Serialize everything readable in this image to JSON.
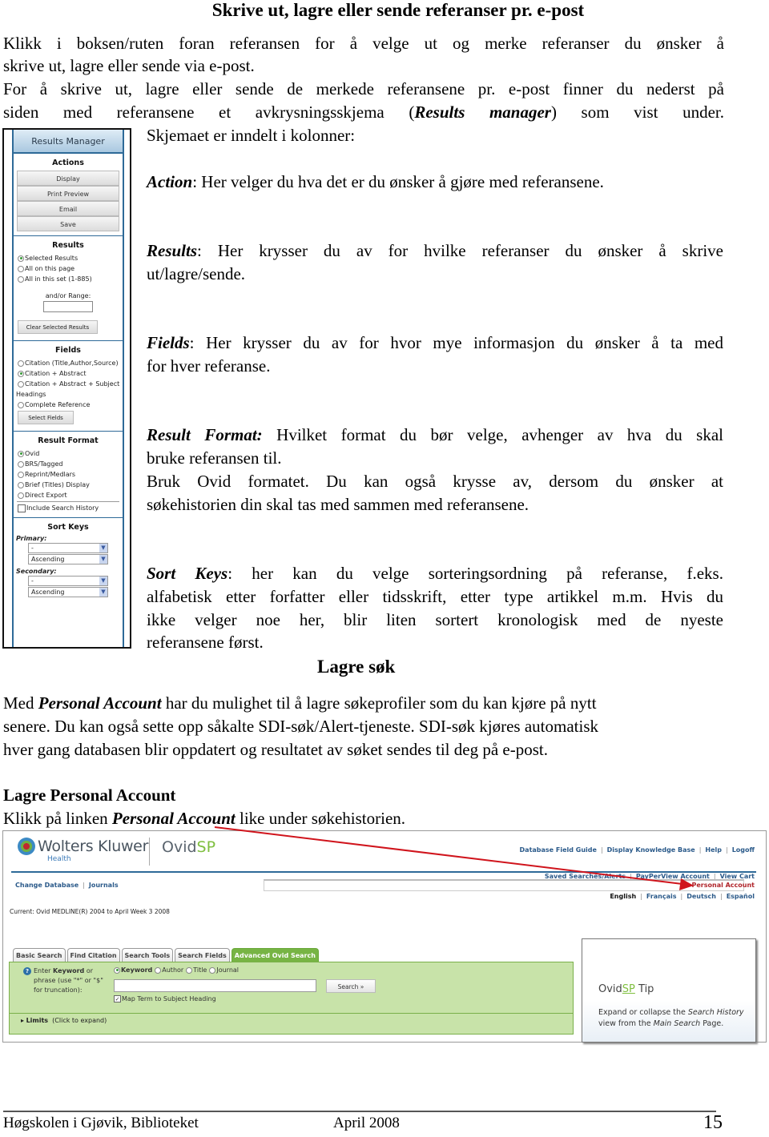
{
  "doc": {
    "title": "Skrive ut, lagre eller sende referanser pr. e-post",
    "intro": {
      "line1": "Klikk i boksen/ruten foran referansen for å velge ut og merke referanser du ønsker å",
      "line2": "skrive ut, lagre eller sende via e-post.",
      "line3": "For å skrive ut, lagre eller sende de merkede referansene pr. e-post finner du nederst på",
      "line4_a": "siden med referansene et avkrysningsskjema (",
      "line4_em": "Results manager",
      "line4_b": ") som vist under.",
      "line5": "Skjemaet er inndelt i kolonner:"
    },
    "items": [
      {
        "term": "Action",
        "sep": ": ",
        "text": "Her velger du hva det er du ønsker å gjøre med referansene."
      },
      {
        "term": "Results",
        "sep": ": ",
        "text1": "Her krysser du av for hvilke referanser du ønsker å skrive",
        "text2": "ut/lagre/sende."
      },
      {
        "term": "Fields",
        "sep": ": ",
        "text1": "Her krysser du av for hvor mye informasjon du ønsker å ta med",
        "text2": "for hver referanse."
      },
      {
        "term": "Result Format:",
        "sep": " ",
        "text1": "Hvilket format du bør velge, avhenger av hva du skal",
        "text2": "bruke referansen til.",
        "text3": "Bruk Ovid formatet. Du kan også krysse av, dersom du ønsker at",
        "text4": "søkehistorien din skal tas med sammen med referansene."
      },
      {
        "term": "Sort Keys",
        "sep": ": ",
        "text1": "her kan du velge sorteringsordning på referanse, f.eks.",
        "text2": "alfabetisk etter forfatter eller tidsskrift, etter type artikkel m.m. Hvis du",
        "text3": "ikke velger noe her, blir liten sortert kronologisk med de nyeste",
        "text4": "referansene først."
      }
    ],
    "heading2": "Lagre søk",
    "para2": {
      "pre": "Med ",
      "em": "Personal Account",
      "line1_post": " har du mulighet til å lagre søkeprofiler som du kan kjøre på nytt",
      "line2": "senere. Du kan også sette opp såkalte SDI-søk/Alert-tjeneste. SDI-søk kjøres automatisk",
      "line3": "hver gang databasen blir oppdatert og resultatet av søket sendes til deg på e-post."
    },
    "heading3": "Lagre Personal Account",
    "para3": {
      "pre": "Klikk på linken ",
      "em": "Personal Account",
      "post": " like under søkehistorien."
    },
    "footer": {
      "left": "Høgskolen i Gjøvik, Biblioteket",
      "center": "April 2008",
      "page": "15"
    }
  },
  "results_manager": {
    "header": "Results Manager",
    "actions": {
      "title": "Actions",
      "buttons": [
        "Display",
        "Print Preview",
        "Email",
        "Save"
      ]
    },
    "results": {
      "title": "Results",
      "options": [
        {
          "label": "Selected Results",
          "selected": true
        },
        {
          "label": "All on this page",
          "selected": false
        },
        {
          "label": "All in this set (1-885)",
          "selected": false
        }
      ],
      "range_label": "and/or Range:",
      "range_value": "",
      "clear_button": "Clear Selected Results"
    },
    "fields": {
      "title": "Fields",
      "options": [
        {
          "label": "Citation (Title,Author,Source)",
          "selected": false
        },
        {
          "label": "Citation + Abstract",
          "selected": true
        },
        {
          "label": "Citation + Abstract + Subject",
          "selected": false
        }
      ],
      "wrap_text": "Headings",
      "option4": {
        "label": "Complete Reference",
        "selected": false
      },
      "select_button": "Select Fields"
    },
    "result_format": {
      "title": "Result Format",
      "options": [
        {
          "label": "Ovid",
          "selected": true
        },
        {
          "label": "BRS/Tagged",
          "selected": false
        },
        {
          "label": "Reprint/Medlars",
          "selected": false
        },
        {
          "label": "Brief (Titles) Display",
          "selected": false
        },
        {
          "label": "Direct Export",
          "selected": false
        }
      ],
      "include_history_label": "Include Search History",
      "include_history_checked": false
    },
    "sort_keys": {
      "title": "Sort Keys",
      "primary_label": "Primary:",
      "primary_field": "-",
      "primary_order": "Ascending",
      "secondary_label": "Secondary:",
      "secondary_field": "-",
      "secondary_order": "Ascending"
    }
  },
  "ovid": {
    "brand": "Wolters Kluwer",
    "brand_sub": "Health",
    "product_a": "Ovid",
    "product_b": "SP",
    "top_links": [
      "Database Field Guide",
      "Display Knowledge Base",
      "Help",
      "Logoff"
    ],
    "sub_links": [
      "Saved Searches/Alerts",
      "PayPerView Account",
      "View Cart"
    ],
    "personal_account": "Personal Account",
    "languages": [
      "English",
      "Français",
      "Deutsch",
      "Español"
    ],
    "active_language": "English",
    "nav_links": [
      "Change Database",
      "Journals"
    ],
    "current_label": "Current:",
    "current_db": "Ovid MEDLINE(R) 2004 to April Week 3 2008",
    "tabs": [
      {
        "label": "Basic Search",
        "active": false
      },
      {
        "label": "Find Citation",
        "active": false
      },
      {
        "label": "Search Tools",
        "active": false
      },
      {
        "label": "Search Fields",
        "active": false
      },
      {
        "label": "Advanced Ovid Search",
        "active": true
      }
    ],
    "enter_keyword": {
      "pre": "Enter ",
      "bold": "Keyword",
      "post": " or phrase (use \"*\" or \"$\" for truncation):"
    },
    "search_types": [
      {
        "label": "Keyword",
        "selected": true
      },
      {
        "label": "Author",
        "selected": false
      },
      {
        "label": "Title",
        "selected": false
      },
      {
        "label": "Journal",
        "selected": false
      }
    ],
    "search_value": "",
    "search_button": "Search »",
    "map_term_label": "Map Term to Subject Heading",
    "map_term_checked": true,
    "limits_label": "Limits",
    "limits_hint": "(Click to expand)",
    "tip": {
      "title_a": "Ovid",
      "title_b": "SP",
      "title_c": " Tip",
      "text_1": "Expand or collapse the ",
      "text_em1": "Search History",
      "text_2": " view from the ",
      "text_em2": "Main Search",
      "text_3": " Page."
    }
  },
  "colors": {
    "ovid_green": "#77b444",
    "panel_green": "#c8e3a9",
    "link_blue": "#2b5a8a",
    "arrow_red": "#d0141c",
    "rm_blue": "#2e6a98"
  }
}
